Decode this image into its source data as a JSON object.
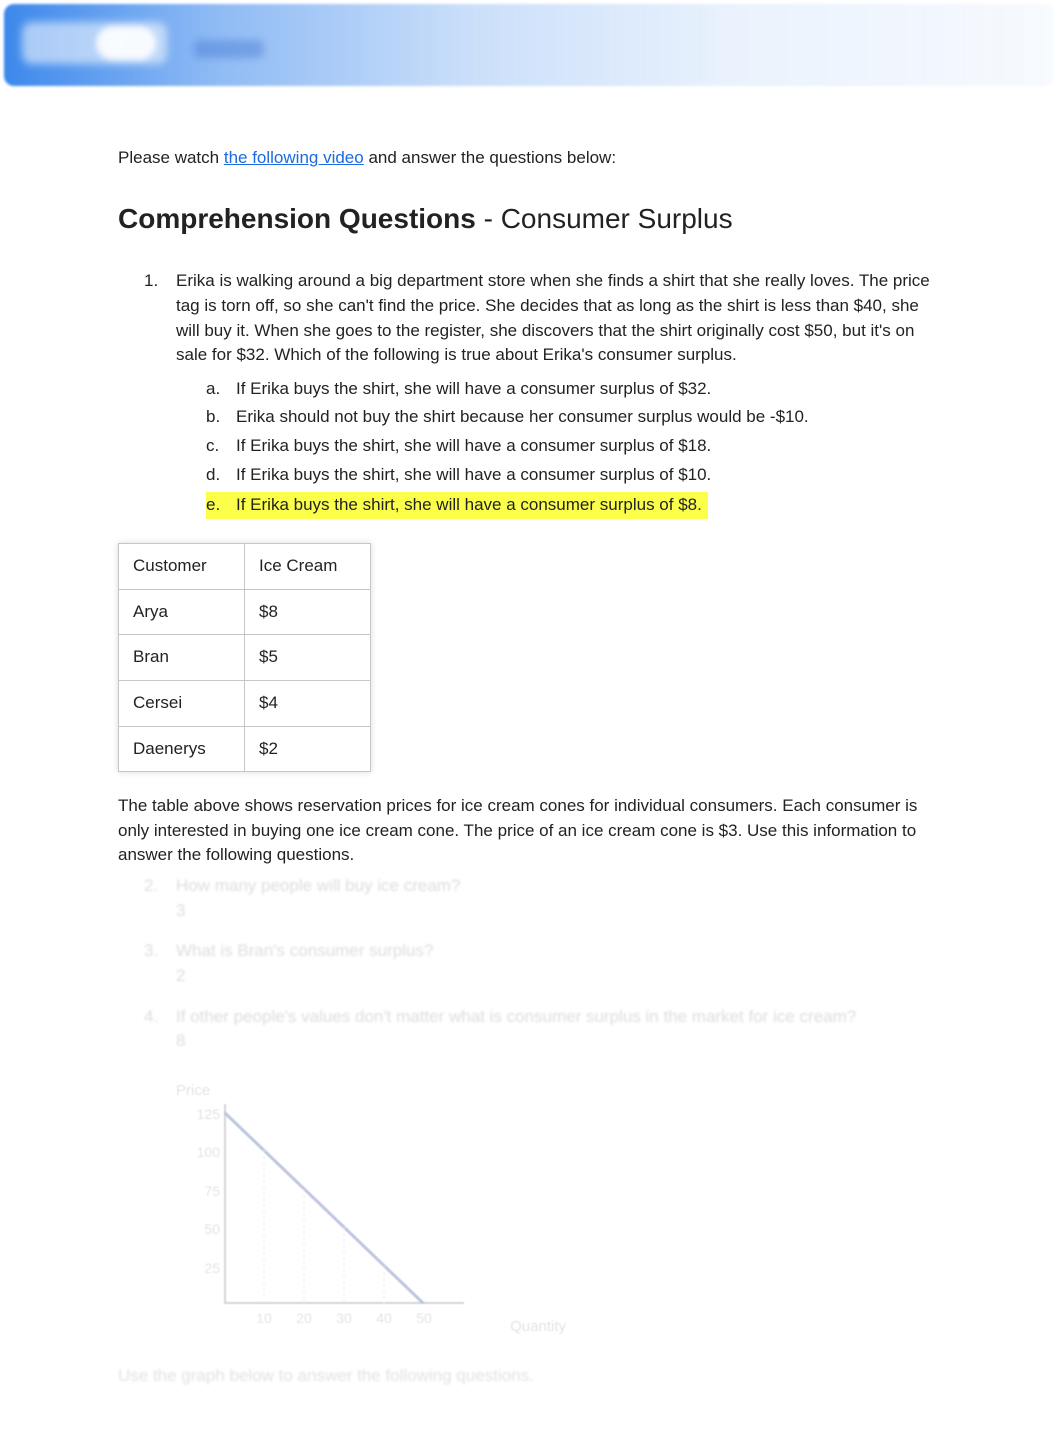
{
  "intro": {
    "prefix": "Please watch ",
    "link_text": "the following video",
    "suffix": " and answer the questions below:"
  },
  "heading": {
    "bold": "Comprehension Questions",
    "rest": " - Consumer Surplus"
  },
  "q1": {
    "num": "1.",
    "text": "Erika is walking around a big department store when she finds a shirt that she really loves. The price tag is torn off, so she can't find the price. She decides that as long as the shirt is less than $40, she will buy it. When she goes to the register, she discovers that the shirt originally cost $50, but it's on sale for $32. Which of the following is true about Erika's consumer surplus.",
    "choices": [
      {
        "letter": "a.",
        "text": "If Erika buys the shirt, she will have a consumer surplus of $32.",
        "hl": false
      },
      {
        "letter": "b.",
        "text": "Erika should not buy the shirt because her consumer surplus would be -$10.",
        "hl": false
      },
      {
        "letter": "c.",
        "text": "If Erika buys the shirt, she will have a consumer surplus of $18.",
        "hl": false
      },
      {
        "letter": "d.",
        "text": "If Erika buys the shirt, she will have a consumer surplus of $10.",
        "hl": false
      },
      {
        "letter": "e.",
        "text": "If Erika buys the shirt, she will have a consumer surplus of $8.",
        "hl": true
      }
    ]
  },
  "table": {
    "headers": [
      "Customer",
      "Ice Cream"
    ],
    "rows": [
      [
        "Arya",
        "$8"
      ],
      [
        "Bran",
        "$5"
      ],
      [
        "Cersei",
        "$4"
      ],
      [
        "Daenerys",
        "$2"
      ]
    ]
  },
  "table_caption": "The table above shows reservation prices for ice cream cones for individual consumers. Each consumer is only interested in buying one ice cream cone. The price of an ice cream cone is $3. Use this information to answer the following questions.",
  "q2": {
    "num": "2.",
    "text": "How many people will buy ice cream?",
    "ans": "3"
  },
  "q3": {
    "num": "3.",
    "text": "What is Bran's consumer surplus?",
    "ans": "2"
  },
  "q4": {
    "num": "4.",
    "text": "If other people's values don't matter what is consumer surplus in the market for ice cream?",
    "ans": "8"
  },
  "graph_caption": "Use the graph below to answer the following questions.",
  "chart_data": {
    "type": "line",
    "title": "Price",
    "xlabel": "Quantity",
    "ylabel": "Price",
    "x": [
      0,
      50
    ],
    "y": [
      125,
      0
    ],
    "xticks": [
      10,
      20,
      30,
      40,
      50
    ],
    "yticks": [
      25,
      50,
      75,
      100,
      125
    ],
    "xlim": [
      0,
      60
    ],
    "ylim": [
      0,
      130
    ]
  }
}
